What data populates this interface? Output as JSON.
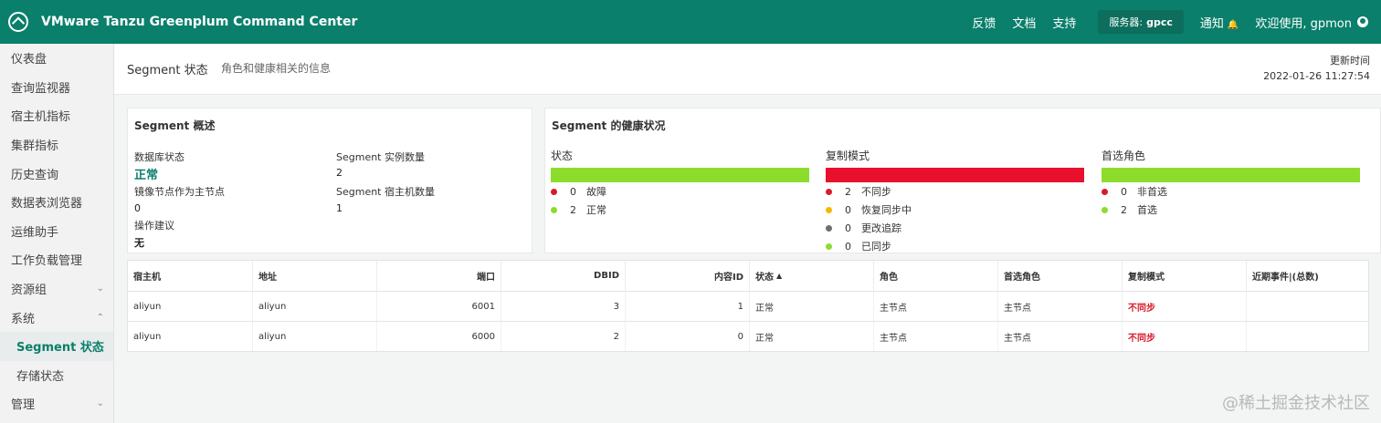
{
  "header": {
    "app_title": "VMware Tanzu Greenplum Command Center",
    "links": [
      "反馈",
      "文档",
      "支持"
    ],
    "server_label": "服务器:",
    "server_value": "gpcc",
    "notify_label": "通知",
    "welcome": "欢迎使用, gpmon"
  },
  "sidebar": {
    "items": [
      "仪表盘",
      "查询监视器",
      "宿主机指标",
      "集群指标",
      "历史查询",
      "数据表浏览器",
      "运维助手",
      "工作负载管理",
      "资源组",
      "系统",
      "Segment 状态",
      "存储状态",
      "管理"
    ]
  },
  "page": {
    "title": "Segment 状态",
    "subtitle": "角色和健康相关的信息",
    "updated_label": "更新时间",
    "updated_time": "2022-01-26 11:27:54"
  },
  "overview": {
    "title": "Segment 概述",
    "db_state_label": "数据库状态",
    "db_state_value": "正常",
    "mirror_label": "镜像节点作为主节点",
    "mirror_value": "0",
    "advice_label": "操作建议",
    "advice_value": "无",
    "instances_label": "Segment 实例数量",
    "instances_value": "2",
    "hosts_label": "Segment 宿主机数量",
    "hosts_value": "1"
  },
  "health": {
    "title": "Segment 的健康状况",
    "columns": [
      {
        "title": "状态",
        "bar_color": "#8ddc2c",
        "rows": [
          {
            "count": "0",
            "label": "故障",
            "color": "#d81b2c"
          },
          {
            "count": "2",
            "label": "正常",
            "color": "#8ddc2c"
          }
        ]
      },
      {
        "title": "复制模式",
        "bar_color": "#e8102c",
        "rows": [
          {
            "count": "2",
            "label": "不同步",
            "color": "#d81b2c"
          },
          {
            "count": "0",
            "label": "恢复同步中",
            "color": "#f5b800"
          },
          {
            "count": "0",
            "label": "更改追踪",
            "color": "#6e6e6e"
          },
          {
            "count": "0",
            "label": "已同步",
            "color": "#8ddc2c"
          }
        ]
      },
      {
        "title": "首选角色",
        "bar_color": "#8ddc2c",
        "rows": [
          {
            "count": "0",
            "label": "非首选",
            "color": "#d81b2c"
          },
          {
            "count": "2",
            "label": "首选",
            "color": "#8ddc2c"
          }
        ]
      }
    ]
  },
  "table": {
    "headers": [
      "宿主机",
      "地址",
      "端口",
      "DBID",
      "内容ID",
      "状态",
      "角色",
      "首选角色",
      "复制模式",
      "近期事件|(总数)"
    ],
    "rows": [
      [
        "aliyun",
        "aliyun",
        "6001",
        "3",
        "1",
        "正常",
        "主节点",
        "主节点",
        "不同步",
        ""
      ],
      [
        "aliyun",
        "aliyun",
        "6000",
        "2",
        "0",
        "正常",
        "主节点",
        "主节点",
        "不同步",
        ""
      ]
    ]
  },
  "watermark": "@稀土掘金技术社区"
}
